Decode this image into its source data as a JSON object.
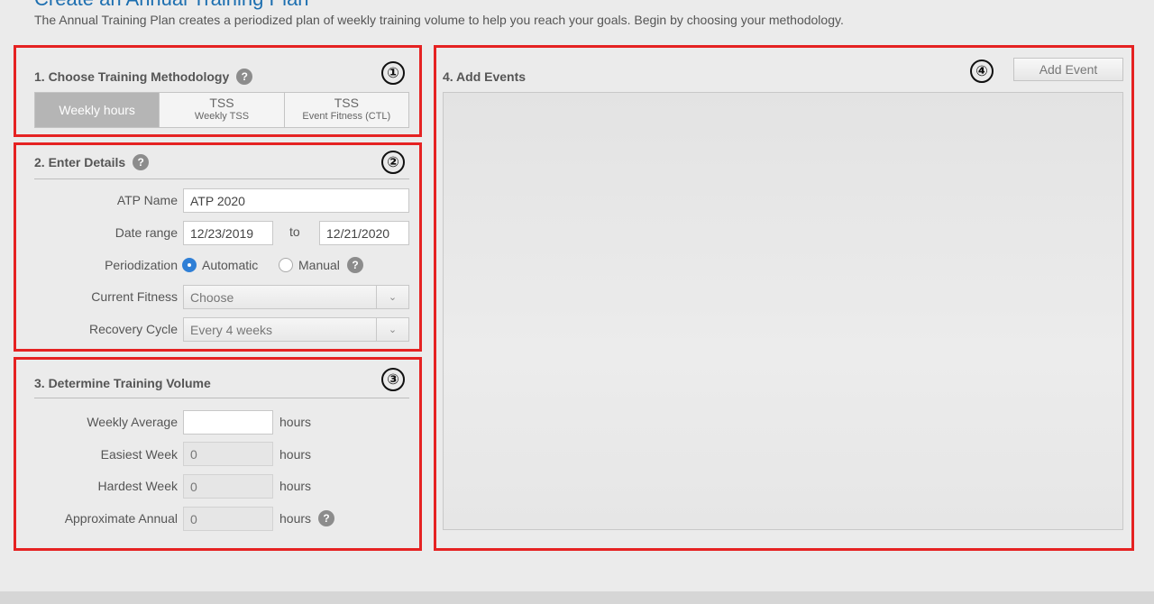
{
  "page": {
    "title": "Create an Annual Training Plan",
    "intro": "The Annual Training Plan creates a periodized plan of weekly training volume to help you reach your goals. Begin by choosing your methodology."
  },
  "badges": [
    "①",
    "②",
    "③",
    "④"
  ],
  "help_glyph": "?",
  "section1": {
    "title": "1. Choose Training Methodology",
    "options": [
      {
        "label": "Weekly hours",
        "sub": "",
        "active": true
      },
      {
        "label": "TSS",
        "sub": "Weekly TSS",
        "active": false
      },
      {
        "label": "TSS",
        "sub": "Event Fitness (CTL)",
        "active": false
      }
    ]
  },
  "section2": {
    "title": "2. Enter Details",
    "atp_name_label": "ATP Name",
    "atp_name_value": "ATP 2020",
    "date_range_label": "Date range",
    "date_from": "12/23/2019",
    "to_label": "to",
    "date_to": "12/21/2020",
    "periodization_label": "Periodization",
    "automatic_label": "Automatic",
    "manual_label": "Manual",
    "current_fitness_label": "Current Fitness",
    "current_fitness_value": "Choose",
    "recovery_cycle_label": "Recovery Cycle",
    "recovery_cycle_value": "Every 4 weeks"
  },
  "section3": {
    "title": "3. Determine Training Volume",
    "weekly_average_label": "Weekly Average",
    "weekly_average_value": "",
    "easiest_week_label": "Easiest Week",
    "easiest_week_value": "0",
    "hardest_week_label": "Hardest Week",
    "hardest_week_value": "0",
    "approx_annual_label": "Approximate Annual",
    "approx_annual_value": "0",
    "unit": "hours"
  },
  "section4": {
    "title": "4. Add Events",
    "add_event_label": "Add Event"
  },
  "colors": {
    "highlight": "#e52222",
    "title_blue": "#1d6fb0",
    "radio_on": "#2f7fd6"
  }
}
